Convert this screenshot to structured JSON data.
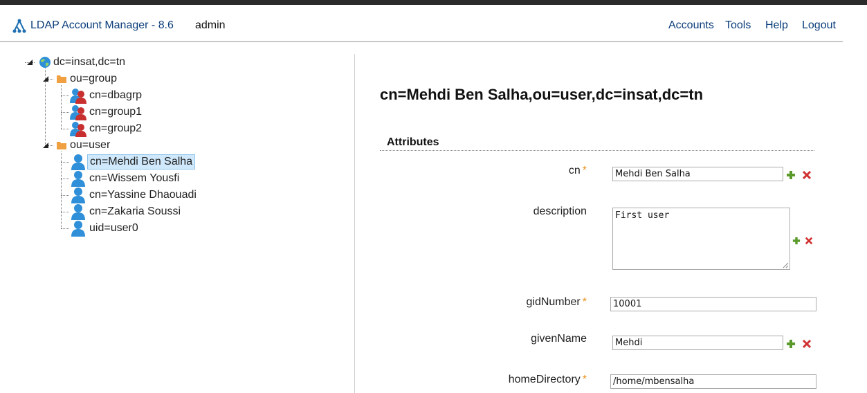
{
  "header": {
    "app_title": "LDAP Account Manager - 8.6",
    "user": "admin",
    "nav": [
      "Accounts",
      "Tools",
      "Help",
      "Logout"
    ]
  },
  "tree": {
    "root": "dc=insat,dc=tn",
    "group_ou": "ou=group",
    "groups": [
      "cn=dbagrp",
      "cn=group1",
      "cn=group2"
    ],
    "user_ou": "ou=user",
    "users": [
      "cn=Mehdi Ben Salha",
      "cn=Wissem Yousfi",
      "cn=Yassine Dhaouadi",
      "cn=Zakaria Soussi",
      "uid=user0"
    ],
    "selected": "cn=Mehdi Ben Salha"
  },
  "main": {
    "dn": "cn=Mehdi Ben Salha,ou=user,dc=insat,dc=tn",
    "section": "Attributes",
    "required_marker": "*",
    "attributes": {
      "cn": {
        "label": "cn",
        "value": "Mehdi Ben Salha"
      },
      "description": {
        "label": "description",
        "value": "First user"
      },
      "gidNumber": {
        "label": "gidNumber",
        "value": "10001"
      },
      "givenName": {
        "label": "givenName",
        "value": "Mehdi"
      },
      "homeDirectory": {
        "label": "homeDirectory",
        "value": "/home/mbensalha"
      }
    }
  },
  "colors": {
    "link": "#0a3d7a",
    "required": "#e8901a",
    "add": "#5a9a2a",
    "delete": "#d03030",
    "selected_bg": "#cfe8fb"
  }
}
